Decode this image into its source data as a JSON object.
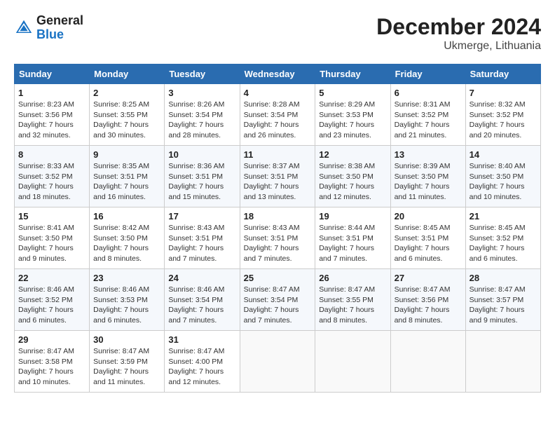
{
  "header": {
    "logo_general": "General",
    "logo_blue": "Blue",
    "month_title": "December 2024",
    "location": "Ukmerge, Lithuania"
  },
  "days_of_week": [
    "Sunday",
    "Monday",
    "Tuesday",
    "Wednesday",
    "Thursday",
    "Friday",
    "Saturday"
  ],
  "weeks": [
    [
      {
        "day": "1",
        "sunrise": "Sunrise: 8:23 AM",
        "sunset": "Sunset: 3:56 PM",
        "daylight": "Daylight: 7 hours and 32 minutes."
      },
      {
        "day": "2",
        "sunrise": "Sunrise: 8:25 AM",
        "sunset": "Sunset: 3:55 PM",
        "daylight": "Daylight: 7 hours and 30 minutes."
      },
      {
        "day": "3",
        "sunrise": "Sunrise: 8:26 AM",
        "sunset": "Sunset: 3:54 PM",
        "daylight": "Daylight: 7 hours and 28 minutes."
      },
      {
        "day": "4",
        "sunrise": "Sunrise: 8:28 AM",
        "sunset": "Sunset: 3:54 PM",
        "daylight": "Daylight: 7 hours and 26 minutes."
      },
      {
        "day": "5",
        "sunrise": "Sunrise: 8:29 AM",
        "sunset": "Sunset: 3:53 PM",
        "daylight": "Daylight: 7 hours and 23 minutes."
      },
      {
        "day": "6",
        "sunrise": "Sunrise: 8:31 AM",
        "sunset": "Sunset: 3:52 PM",
        "daylight": "Daylight: 7 hours and 21 minutes."
      },
      {
        "day": "7",
        "sunrise": "Sunrise: 8:32 AM",
        "sunset": "Sunset: 3:52 PM",
        "daylight": "Daylight: 7 hours and 20 minutes."
      }
    ],
    [
      {
        "day": "8",
        "sunrise": "Sunrise: 8:33 AM",
        "sunset": "Sunset: 3:52 PM",
        "daylight": "Daylight: 7 hours and 18 minutes."
      },
      {
        "day": "9",
        "sunrise": "Sunrise: 8:35 AM",
        "sunset": "Sunset: 3:51 PM",
        "daylight": "Daylight: 7 hours and 16 minutes."
      },
      {
        "day": "10",
        "sunrise": "Sunrise: 8:36 AM",
        "sunset": "Sunset: 3:51 PM",
        "daylight": "Daylight: 7 hours and 15 minutes."
      },
      {
        "day": "11",
        "sunrise": "Sunrise: 8:37 AM",
        "sunset": "Sunset: 3:51 PM",
        "daylight": "Daylight: 7 hours and 13 minutes."
      },
      {
        "day": "12",
        "sunrise": "Sunrise: 8:38 AM",
        "sunset": "Sunset: 3:50 PM",
        "daylight": "Daylight: 7 hours and 12 minutes."
      },
      {
        "day": "13",
        "sunrise": "Sunrise: 8:39 AM",
        "sunset": "Sunset: 3:50 PM",
        "daylight": "Daylight: 7 hours and 11 minutes."
      },
      {
        "day": "14",
        "sunrise": "Sunrise: 8:40 AM",
        "sunset": "Sunset: 3:50 PM",
        "daylight": "Daylight: 7 hours and 10 minutes."
      }
    ],
    [
      {
        "day": "15",
        "sunrise": "Sunrise: 8:41 AM",
        "sunset": "Sunset: 3:50 PM",
        "daylight": "Daylight: 7 hours and 9 minutes."
      },
      {
        "day": "16",
        "sunrise": "Sunrise: 8:42 AM",
        "sunset": "Sunset: 3:50 PM",
        "daylight": "Daylight: 7 hours and 8 minutes."
      },
      {
        "day": "17",
        "sunrise": "Sunrise: 8:43 AM",
        "sunset": "Sunset: 3:51 PM",
        "daylight": "Daylight: 7 hours and 7 minutes."
      },
      {
        "day": "18",
        "sunrise": "Sunrise: 8:43 AM",
        "sunset": "Sunset: 3:51 PM",
        "daylight": "Daylight: 7 hours and 7 minutes."
      },
      {
        "day": "19",
        "sunrise": "Sunrise: 8:44 AM",
        "sunset": "Sunset: 3:51 PM",
        "daylight": "Daylight: 7 hours and 7 minutes."
      },
      {
        "day": "20",
        "sunrise": "Sunrise: 8:45 AM",
        "sunset": "Sunset: 3:51 PM",
        "daylight": "Daylight: 7 hours and 6 minutes."
      },
      {
        "day": "21",
        "sunrise": "Sunrise: 8:45 AM",
        "sunset": "Sunset: 3:52 PM",
        "daylight": "Daylight: 7 hours and 6 minutes."
      }
    ],
    [
      {
        "day": "22",
        "sunrise": "Sunrise: 8:46 AM",
        "sunset": "Sunset: 3:52 PM",
        "daylight": "Daylight: 7 hours and 6 minutes."
      },
      {
        "day": "23",
        "sunrise": "Sunrise: 8:46 AM",
        "sunset": "Sunset: 3:53 PM",
        "daylight": "Daylight: 7 hours and 6 minutes."
      },
      {
        "day": "24",
        "sunrise": "Sunrise: 8:46 AM",
        "sunset": "Sunset: 3:54 PM",
        "daylight": "Daylight: 7 hours and 7 minutes."
      },
      {
        "day": "25",
        "sunrise": "Sunrise: 8:47 AM",
        "sunset": "Sunset: 3:54 PM",
        "daylight": "Daylight: 7 hours and 7 minutes."
      },
      {
        "day": "26",
        "sunrise": "Sunrise: 8:47 AM",
        "sunset": "Sunset: 3:55 PM",
        "daylight": "Daylight: 7 hours and 8 minutes."
      },
      {
        "day": "27",
        "sunrise": "Sunrise: 8:47 AM",
        "sunset": "Sunset: 3:56 PM",
        "daylight": "Daylight: 7 hours and 8 minutes."
      },
      {
        "day": "28",
        "sunrise": "Sunrise: 8:47 AM",
        "sunset": "Sunset: 3:57 PM",
        "daylight": "Daylight: 7 hours and 9 minutes."
      }
    ],
    [
      {
        "day": "29",
        "sunrise": "Sunrise: 8:47 AM",
        "sunset": "Sunset: 3:58 PM",
        "daylight": "Daylight: 7 hours and 10 minutes."
      },
      {
        "day": "30",
        "sunrise": "Sunrise: 8:47 AM",
        "sunset": "Sunset: 3:59 PM",
        "daylight": "Daylight: 7 hours and 11 minutes."
      },
      {
        "day": "31",
        "sunrise": "Sunrise: 8:47 AM",
        "sunset": "Sunset: 4:00 PM",
        "daylight": "Daylight: 7 hours and 12 minutes."
      },
      null,
      null,
      null,
      null
    ]
  ]
}
